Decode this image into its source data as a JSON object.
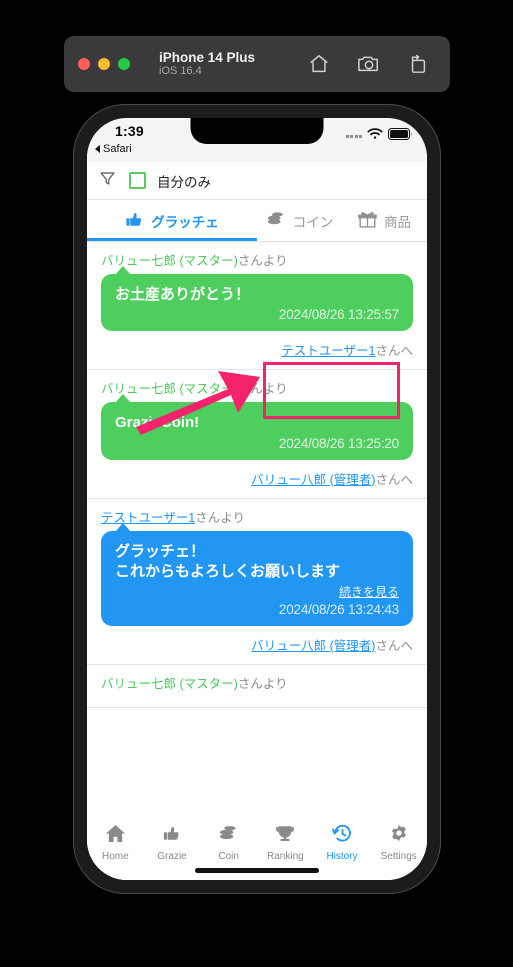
{
  "simulator": {
    "device_name": "iPhone 14 Plus",
    "os_version": "iOS 16.4",
    "window_controls": [
      "close-button",
      "minimize-button",
      "zoom-button"
    ],
    "actions": [
      "home-icon",
      "screenshot-icon",
      "rotate-icon"
    ]
  },
  "status_bar": {
    "time": "1:39",
    "back_app": "Safari",
    "icons": [
      "signal-dots-icon",
      "wifi-icon",
      "battery-icon"
    ]
  },
  "filter_bar": {
    "filter_icon": "funnel-icon",
    "checkbox_checked": false,
    "label": "自分のみ",
    "checkbox_color": "#5cc95c"
  },
  "tabs": [
    {
      "label": "グラッチェ",
      "icon": "thumbs-up-icon",
      "active": true
    },
    {
      "label": "コイン",
      "icon": "coins-icon",
      "active": false
    },
    {
      "label": "商品",
      "icon": "gift-icon",
      "active": false
    }
  ],
  "feed": [
    {
      "sender_name": "バリュー七郎 (マスター)",
      "sender_suffix": "さんより",
      "sender_style": "green",
      "bubble_color": "green",
      "message": "お土産ありがとう！",
      "more_link": "",
      "timestamp": "2024/08/26 13:25:57",
      "recipient_name": "テストユーザー1",
      "recipient_suffix": "さんへ",
      "highlighted": true
    },
    {
      "sender_name": "バリュー七郎 (マスター)",
      "sender_suffix": "さんより",
      "sender_style": "green",
      "bubble_color": "green",
      "message": "GrazieCoin!",
      "more_link": "",
      "timestamp": "2024/08/26 13:25:20",
      "recipient_name": "バリュー八郎 (管理者)",
      "recipient_suffix": "さんへ",
      "highlighted": false
    },
    {
      "sender_name": "テストユーザー1",
      "sender_suffix": "さんより",
      "sender_style": "link",
      "bubble_color": "blue",
      "message": "グラッチェ！\nこれからもよろしくお願いします",
      "more_link": "続きを見る",
      "timestamp": "2024/08/26 13:24:43",
      "recipient_name": "バリュー八郎 (管理者)",
      "recipient_suffix": "さんへ",
      "highlighted": false
    },
    {
      "sender_name": "バリュー七郎 (マスター)",
      "sender_suffix": "さんより",
      "sender_style": "green",
      "bubble_color": "green",
      "message": "",
      "more_link": "",
      "timestamp": "",
      "recipient_name": "",
      "recipient_suffix": "",
      "highlighted": false
    }
  ],
  "bottom_nav": [
    {
      "label": "Home",
      "icon": "home-icon",
      "active": false
    },
    {
      "label": "Grazie",
      "icon": "thumbs-up-icon",
      "active": false
    },
    {
      "label": "Coin",
      "icon": "coins-icon",
      "active": false
    },
    {
      "label": "Ranking",
      "icon": "trophy-icon",
      "active": false
    },
    {
      "label": "History",
      "icon": "history-icon",
      "active": true
    },
    {
      "label": "Settings",
      "icon": "gear-icon",
      "active": false
    }
  ],
  "annotation": {
    "highlight_color": "#f4236c",
    "arrow_color": "#f4236c"
  },
  "colors": {
    "accent_blue": "#2196f3",
    "bubble_green": "#4ece5f",
    "muted_gray": "#8e8e93"
  }
}
